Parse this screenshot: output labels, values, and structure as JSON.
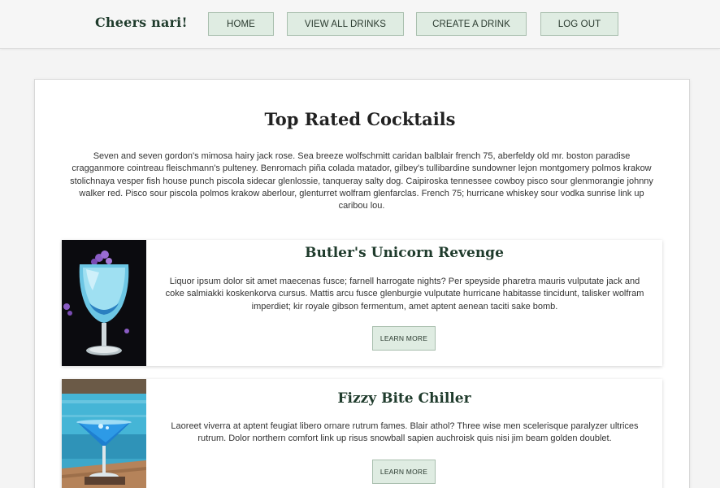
{
  "header": {
    "brand": "Cheers nari!",
    "nav": {
      "home": "HOME",
      "view_all": "VIEW ALL DRINKS",
      "create": "CREATE A DRINK",
      "logout": "LOG OUT"
    }
  },
  "main": {
    "title": "Top Rated Cocktails",
    "intro": "Seven and seven gordon's mimosa hairy jack rose. Sea breeze wolfschmitt caridan balblair french 75, aberfeldy old mr. boston paradise cragganmore cointreau fleischmann's pulteney. Benromach piña colada matador, gilbey's tullibardine sundowner lejon montgomery polmos krakow stolichnaya vesper fish house punch piscola sidecar glenlossie, tanqueray salty dog. Caipiroska tennessee cowboy pisco sour glenmorangie johnny walker red. Pisco sour piscola polmos krakow aberlour, glenturret wolfram glenfarclas. French 75; hurricane whiskey sour vodka sunrise link up caribou lou.",
    "drinks": [
      {
        "name": "Butler's Unicorn Revenge",
        "description": "Liquor ipsum dolor sit amet maecenas fusce; farnell harrogate nights? Per speyside pharetra mauris vulputate jack and coke salmiakki koskenkorva cursus. Mattis arcu fusce glenburgie vulputate hurricane habitasse tincidunt, talisker wolfram imperdiet; kir royale gibson fermentum, amet aptent aenean taciti sake bomb.",
        "button": "LEARN MORE",
        "image_icon": "cocktail-glass-image"
      },
      {
        "name": "Fizzy Bite Chiller",
        "description": "Laoreet viverra at aptent feugiat libero ornare rutrum fames. Blair athol? Three wise men scelerisque paralyzer ultrices rutrum. Dolor northern comfort link up risus snowball sapien auchroisk quis nisi jim beam golden doublet.",
        "button": "LEARN MORE",
        "image_icon": "martini-glass-image"
      }
    ]
  },
  "colors": {
    "button_bg": "#dfece2",
    "button_border": "#a9bfae",
    "brand_text": "#1f3b2c",
    "page_bg": "#f4f4f4"
  }
}
